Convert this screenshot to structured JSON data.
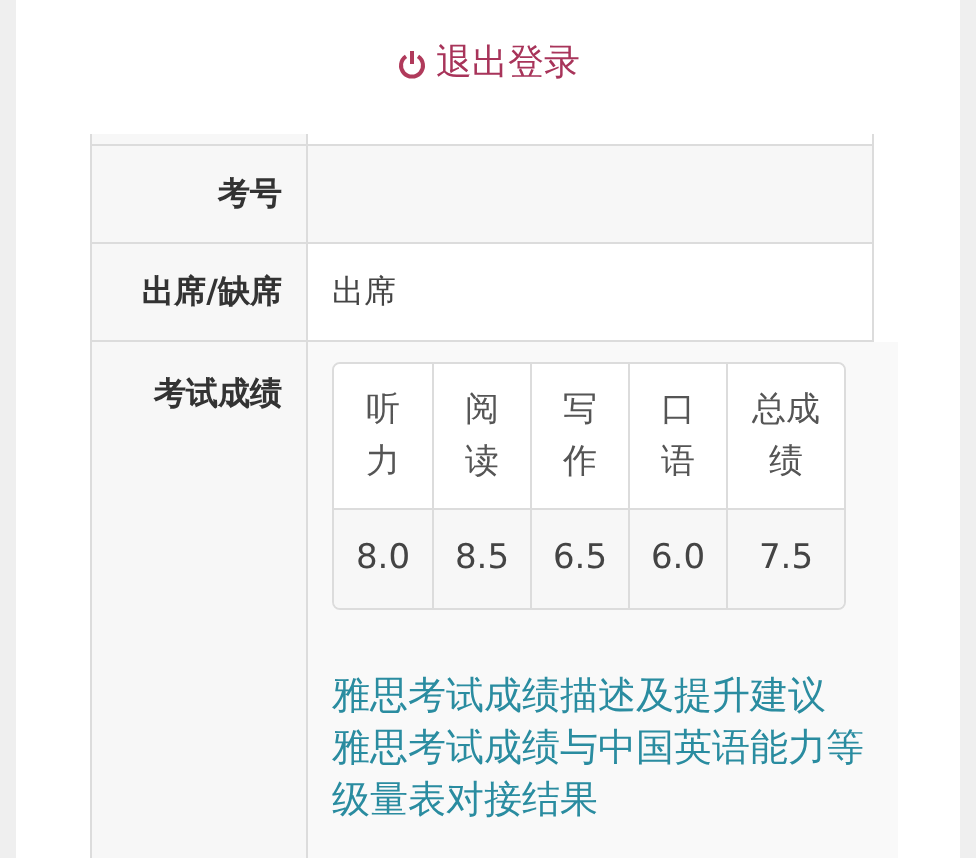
{
  "logout": {
    "label": "退出登录"
  },
  "rows": [
    {
      "kind": "text",
      "label": "考号",
      "value": ""
    },
    {
      "kind": "text",
      "label": "出席/缺席",
      "value": "出席"
    },
    {
      "kind": "scores",
      "label": "考试成绩",
      "scores": [
        {
          "header": "听力",
          "value": "8.0"
        },
        {
          "header": "阅读",
          "value": "8.5"
        },
        {
          "header": "写作",
          "value": "6.5"
        },
        {
          "header": "口语",
          "value": "6.0"
        },
        {
          "header": "总成绩",
          "value": "7.5"
        }
      ],
      "links": [
        "雅思考试成绩描述及提升建议",
        "雅思考试成绩与中国英语能力等级量表对接结果"
      ]
    }
  ]
}
